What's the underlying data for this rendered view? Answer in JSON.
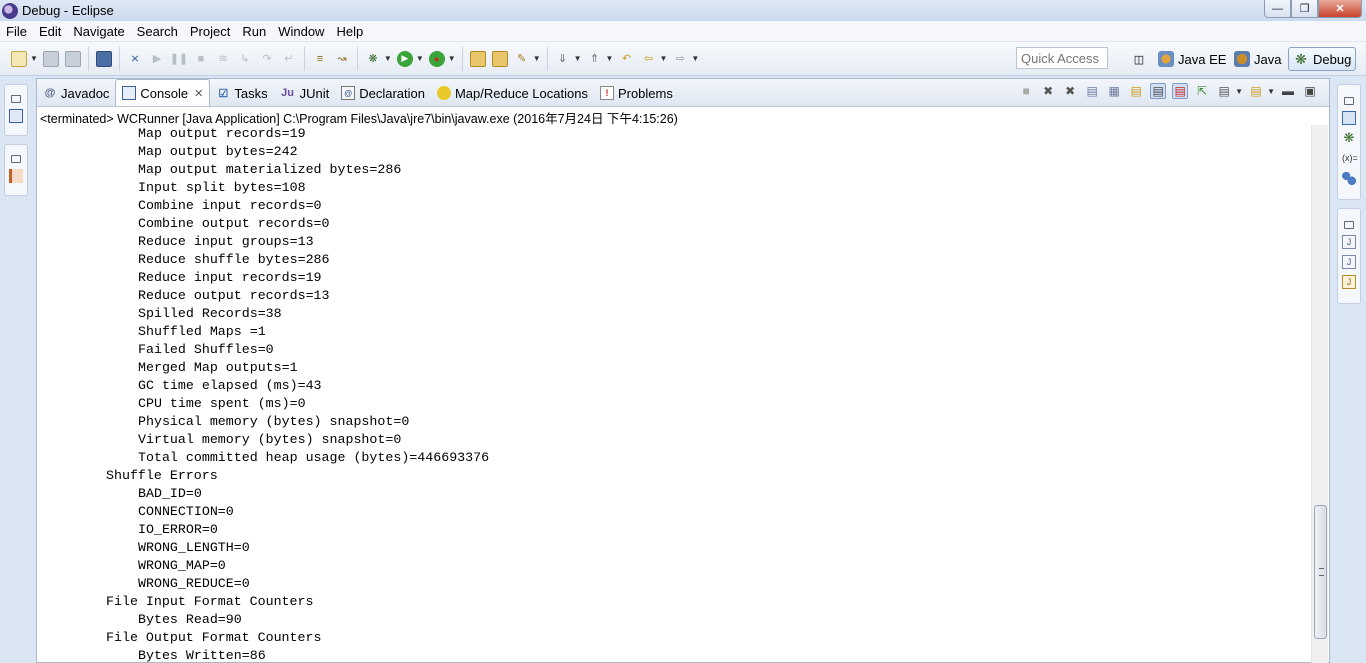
{
  "window": {
    "title": "Debug - Eclipse"
  },
  "menu": [
    "File",
    "Edit",
    "Navigate",
    "Search",
    "Project",
    "Run",
    "Window",
    "Help"
  ],
  "toolbar": {
    "quick_access_placeholder": "Quick Access",
    "perspectives": [
      "Java EE",
      "Java",
      "Debug"
    ]
  },
  "tabs": [
    {
      "label": "Javadoc",
      "icon": "at-icon"
    },
    {
      "label": "Console",
      "icon": "console-icon",
      "active": true
    },
    {
      "label": "Tasks",
      "icon": "tasks-icon"
    },
    {
      "label": "JUnit",
      "icon": "junit-icon"
    },
    {
      "label": "Declaration",
      "icon": "declaration-icon"
    },
    {
      "label": "Map/Reduce Locations",
      "icon": "elephant-icon"
    },
    {
      "label": "Problems",
      "icon": "problems-icon"
    }
  ],
  "console": {
    "status": "<terminated> WCRunner [Java Application] C:\\Program Files\\Java\\jre7\\bin\\javaw.exe (2016年7月24日 下午4:15:26)",
    "lines": [
      "\t\tMap output records=19",
      "\t\tMap output bytes=242",
      "\t\tMap output materialized bytes=286",
      "\t\tInput split bytes=108",
      "\t\tCombine input records=0",
      "\t\tCombine output records=0",
      "\t\tReduce input groups=13",
      "\t\tReduce shuffle bytes=286",
      "\t\tReduce input records=19",
      "\t\tReduce output records=13",
      "\t\tSpilled Records=38",
      "\t\tShuffled Maps =1",
      "\t\tFailed Shuffles=0",
      "\t\tMerged Map outputs=1",
      "\t\tGC time elapsed (ms)=43",
      "\t\tCPU time spent (ms)=0",
      "\t\tPhysical memory (bytes) snapshot=0",
      "\t\tVirtual memory (bytes) snapshot=0",
      "\t\tTotal committed heap usage (bytes)=446693376",
      "\tShuffle Errors",
      "\t\tBAD_ID=0",
      "\t\tCONNECTION=0",
      "\t\tIO_ERROR=0",
      "\t\tWRONG_LENGTH=0",
      "\t\tWRONG_MAP=0",
      "\t\tWRONG_REDUCE=0",
      "\tFile Input Format Counters ",
      "\t\tBytes Read=90",
      "\tFile Output Format Counters ",
      "\t\tBytes Written=86"
    ],
    "scroll_position": 0.95
  }
}
